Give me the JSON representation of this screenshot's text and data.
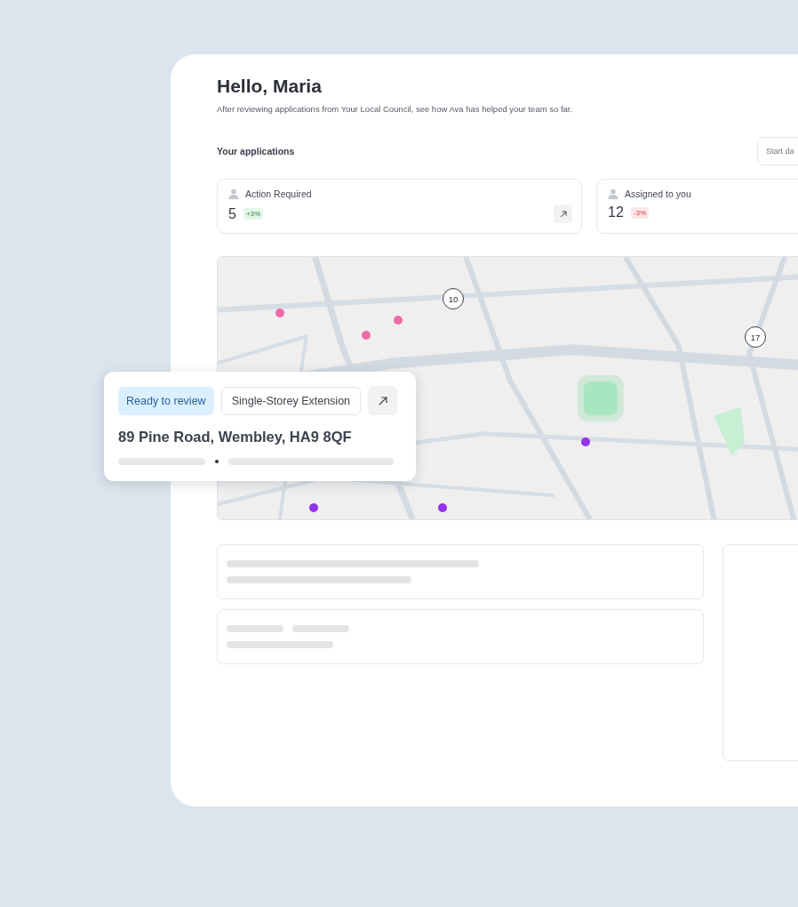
{
  "greeting": "Hello, Maria",
  "subtitle": "After reviewing applications from Your Local Council, see how Ava has helped your team so far.",
  "section_title": "Your applications",
  "date_field": {
    "placeholder": "Start da"
  },
  "stats": [
    {
      "label": "Action Required",
      "value": "5",
      "change": "+3%",
      "positive": true
    },
    {
      "label": "Assigned to you",
      "value": "12",
      "change": "-3%",
      "positive": false
    }
  ],
  "map": {
    "kind": "picture",
    "clusters": [
      {
        "label": "10"
      },
      {
        "label": "17"
      }
    ],
    "pins": [
      {
        "color": "#f06aa8"
      },
      {
        "color": "#f06aa8"
      },
      {
        "color": "#f06aa8"
      },
      {
        "color": "#9333ea"
      },
      {
        "color": "#9333ea"
      },
      {
        "color": "#9333ea"
      }
    ]
  },
  "popup": {
    "status": "Ready to review",
    "type": "Single-Storey Extension",
    "address": "89 Pine Road, Wembley, HA9 8QF"
  }
}
